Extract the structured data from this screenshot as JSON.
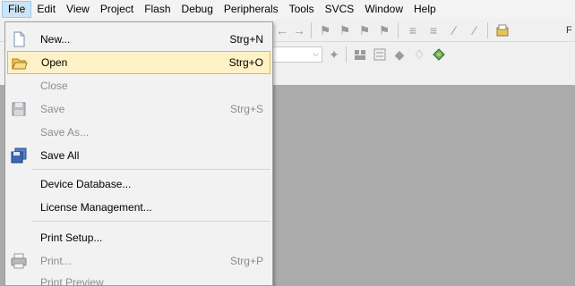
{
  "menubar": {
    "items": [
      {
        "label": "File"
      },
      {
        "label": "Edit"
      },
      {
        "label": "View"
      },
      {
        "label": "Project"
      },
      {
        "label": "Flash"
      },
      {
        "label": "Debug"
      },
      {
        "label": "Peripherals"
      },
      {
        "label": "Tools"
      },
      {
        "label": "SVCS"
      },
      {
        "label": "Window"
      },
      {
        "label": "Help"
      }
    ]
  },
  "toolbar": {
    "truncated_label": "F"
  },
  "file_menu": {
    "items": [
      {
        "label": "New...",
        "shortcut": "Strg+N",
        "enabled": true,
        "icon": "new-file-icon"
      },
      {
        "label": "Open",
        "shortcut": "Strg+O",
        "enabled": true,
        "highlighted": true,
        "icon": "open-folder-icon"
      },
      {
        "label": "Close",
        "shortcut": "",
        "enabled": false
      },
      {
        "label": "Save",
        "shortcut": "Strg+S",
        "enabled": false,
        "icon": "save-icon"
      },
      {
        "label": "Save As...",
        "shortcut": "",
        "enabled": false
      },
      {
        "label": "Save All",
        "shortcut": "",
        "enabled": true,
        "icon": "save-all-icon"
      },
      {
        "label": "Device Database...",
        "shortcut": "",
        "enabled": true
      },
      {
        "label": "License Management...",
        "shortcut": "",
        "enabled": true
      },
      {
        "label": "Print Setup...",
        "shortcut": "",
        "enabled": true
      },
      {
        "label": "Print...",
        "shortcut": "Strg+P",
        "enabled": false,
        "icon": "print-icon"
      },
      {
        "label": "Print Preview",
        "shortcut": "",
        "enabled": false
      }
    ]
  },
  "colors": {
    "highlight_bg": "#fdf1c5",
    "highlight_border": "#e5b948",
    "workspace": "#ababab",
    "menubar_active": "#cce4f7"
  }
}
